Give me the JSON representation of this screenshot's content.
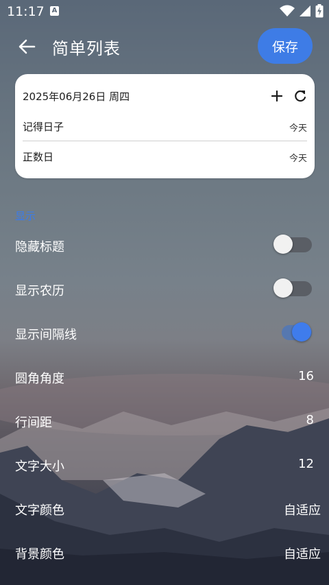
{
  "status_bar": {
    "time": "11:17",
    "indicator": "A"
  },
  "app_bar": {
    "title": "简单列表",
    "save_label": "保存"
  },
  "card": {
    "date": "2025年06月26日 周四",
    "rows": [
      {
        "name": "记得日子",
        "value": "今天"
      },
      {
        "name": "正数日",
        "value": "今天"
      }
    ]
  },
  "section": {
    "label": "显示"
  },
  "settings": [
    {
      "label": "隐藏标题",
      "type": "toggle",
      "on": false
    },
    {
      "label": "显示农历",
      "type": "toggle",
      "on": false
    },
    {
      "label": "显示间隔线",
      "type": "toggle",
      "on": true
    },
    {
      "label": "圆角角度",
      "type": "value",
      "value": "16"
    },
    {
      "label": "行间距",
      "type": "value",
      "value": "8"
    },
    {
      "label": "文字大小",
      "type": "value",
      "value": "12"
    },
    {
      "label": "文字颜色",
      "type": "value",
      "value": "自适应"
    },
    {
      "label": "背景颜色",
      "type": "value",
      "value": "自适应"
    }
  ],
  "colors": {
    "accent": "#3e7ce6",
    "section": "#3a7bec",
    "card": "#ffffff"
  },
  "icons": [
    "back-arrow-icon",
    "plus-icon",
    "refresh-icon",
    "wifi-icon",
    "signal-icon",
    "battery-icon"
  ]
}
